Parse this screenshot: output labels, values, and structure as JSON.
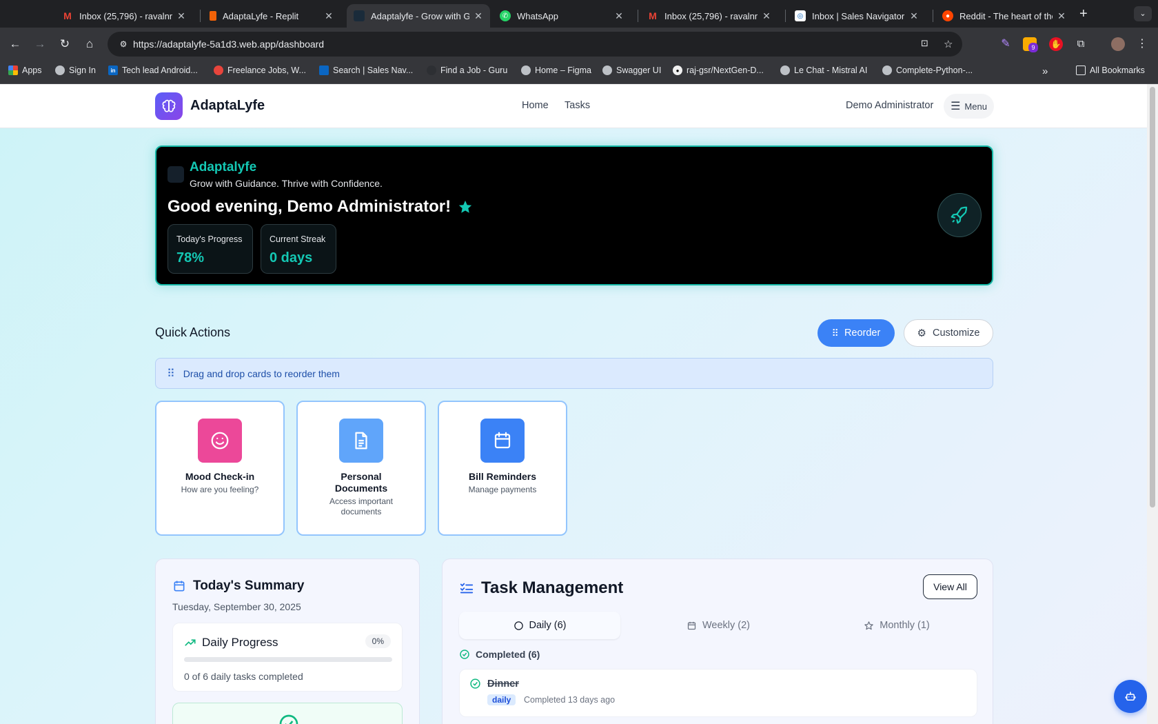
{
  "browser": {
    "tabs": [
      {
        "title": "Inbox (25,796) - ravalnn",
        "favicon": "gmail-icon",
        "color": "#ea4335"
      },
      {
        "title": "AdaptaLyfe - Replit",
        "favicon": "replit-icon",
        "color": "#f26207"
      },
      {
        "title": "Adaptalyfe - Grow with G",
        "favicon": "adaptalyfe-icon",
        "color": "#1a2b3a"
      },
      {
        "title": "WhatsApp",
        "favicon": "whatsapp-icon",
        "color": "#25d366"
      },
      {
        "title": "Inbox (25,796) - ravalnn",
        "favicon": "gmail-icon",
        "color": "#ea4335"
      },
      {
        "title": "Inbox | Sales Navigator",
        "favicon": "linkedin-icon",
        "color": "#0a66c2"
      },
      {
        "title": "Reddit - The heart of the",
        "favicon": "reddit-icon",
        "color": "#ff4500"
      }
    ],
    "url": "https://adaptalyfe-5a1d3.web.app/dashboard",
    "extension_badge": "9",
    "bookmarks": [
      {
        "label": "Apps",
        "icon": "apps-grid-icon"
      },
      {
        "label": "Sign In",
        "icon": "globe-icon"
      },
      {
        "label": "Tech lead Android...",
        "icon": "linkedin-icon"
      },
      {
        "label": "Freelance Jobs, W...",
        "icon": "freelance-icon"
      },
      {
        "label": "Search | Sales Nav...",
        "icon": "compass-icon"
      },
      {
        "label": "Find a Job - Guru",
        "icon": "guru-icon"
      },
      {
        "label": "Home – Figma",
        "icon": "globe-icon"
      },
      {
        "label": "Swagger UI",
        "icon": "globe-icon"
      },
      {
        "label": "raj-gsr/NextGen-D...",
        "icon": "github-icon"
      },
      {
        "label": "Le Chat - Mistral AI",
        "icon": "globe-icon"
      },
      {
        "label": "Complete-Python-...",
        "icon": "globe-icon"
      }
    ],
    "all_bookmarks": "All Bookmarks"
  },
  "app": {
    "brand": "AdaptaLyfe",
    "nav": [
      "Home",
      "Tasks"
    ],
    "user": "Demo Administrator",
    "menu_label": "Menu"
  },
  "hero": {
    "brand": "Adaptalyfe",
    "tagline": "Grow with Guidance. Thrive with Confidence.",
    "greeting": "Good evening, Demo Administrator!",
    "stats": [
      {
        "label": "Today's Progress",
        "value": "78%"
      },
      {
        "label": "Current Streak",
        "value": "0 days"
      }
    ]
  },
  "quick_actions": {
    "title": "Quick Actions",
    "reorder_label": "Reorder",
    "customize_label": "Customize",
    "drag_note": "Drag and drop cards to reorder them",
    "cards": [
      {
        "title": "Mood Check-in",
        "subtitle": "How are you feeling?",
        "icon": "smile-icon",
        "color": "#ec4899"
      },
      {
        "title": "Personal Documents",
        "subtitle": "Access important documents",
        "icon": "document-icon",
        "color": "#60a5fa"
      },
      {
        "title": "Bill Reminders",
        "subtitle": "Manage payments",
        "icon": "calendar-icon",
        "color": "#3b82f6"
      }
    ]
  },
  "summary": {
    "title": "Today's Summary",
    "date": "Tuesday, September 30, 2025",
    "daily_progress": {
      "title": "Daily Progress",
      "percent": "0%",
      "fill": 0,
      "text": "0 of 6 daily tasks completed"
    }
  },
  "tasks": {
    "title": "Task Management",
    "view_all": "View All",
    "tabs": [
      {
        "label": "Daily (6)",
        "icon": "circle-icon"
      },
      {
        "label": "Weekly (2)",
        "icon": "calendar-icon"
      },
      {
        "label": "Monthly (1)",
        "icon": "star-icon"
      }
    ],
    "completed_label": "Completed (6)",
    "items": [
      {
        "name": "Dinner",
        "badge": "daily",
        "when": "Completed 13 days ago"
      }
    ]
  },
  "colors": {
    "accent": "#14b8a6",
    "primary": "#3b82f6",
    "success": "#10b981"
  }
}
